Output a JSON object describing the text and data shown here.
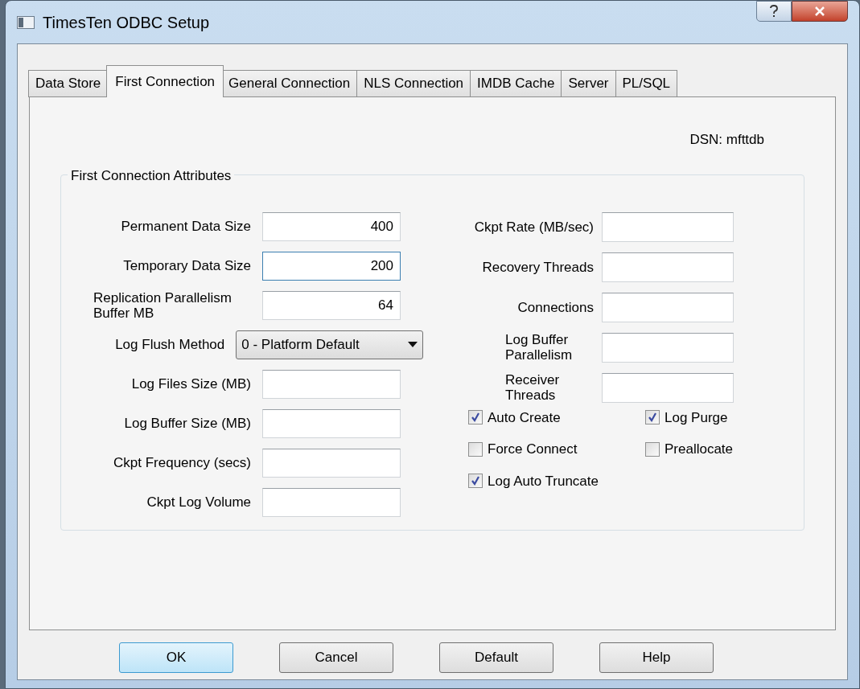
{
  "window": {
    "title": "TimesTen ODBC Setup"
  },
  "tabs": [
    {
      "label": "Data Store",
      "selected": false
    },
    {
      "label": "First Connection",
      "selected": true
    },
    {
      "label": "General Connection",
      "selected": false
    },
    {
      "label": "NLS Connection",
      "selected": false
    },
    {
      "label": "IMDB Cache",
      "selected": false
    },
    {
      "label": "Server",
      "selected": false
    },
    {
      "label": "PL/SQL",
      "selected": false
    }
  ],
  "dsn": "DSN: mfttdb",
  "group": {
    "title": "First Connection Attributes"
  },
  "left_fields": [
    {
      "kind": "text",
      "label": "Permanent Data Size",
      "value": "400",
      "focused": false
    },
    {
      "kind": "text",
      "label": "Temporary Data Size",
      "value": "200",
      "focused": true
    },
    {
      "kind": "text",
      "label": "Replication Parallelism Buffer MB",
      "value": "64",
      "focused": false
    },
    {
      "kind": "dropdown",
      "label": "Log Flush Method",
      "value": "0 - Platform Default"
    },
    {
      "kind": "text",
      "label": "Log Files Size (MB)",
      "focused": false
    },
    {
      "kind": "text",
      "label": "Log Buffer Size (MB)",
      "focused": false
    },
    {
      "kind": "text",
      "label": "Ckpt Frequency (secs)",
      "focused": false
    },
    {
      "kind": "text",
      "label": "Ckpt Log Volume",
      "focused": false
    }
  ],
  "right_fields": [
    {
      "label": "Ckpt Rate (MB/sec)"
    },
    {
      "label": "Recovery Threads"
    },
    {
      "label": "Connections"
    },
    {
      "label": "Log Buffer Parallelism"
    },
    {
      "label": "Receiver Threads"
    }
  ],
  "checkboxes": [
    {
      "label": "Auto Create",
      "checked": true
    },
    {
      "label": "Log Purge",
      "checked": true
    },
    {
      "label": "Force Connect",
      "checked": false
    },
    {
      "label": "Preallocate",
      "checked": false
    },
    {
      "label": "Log Auto Truncate",
      "checked": true
    }
  ],
  "buttons": [
    {
      "label": "OK",
      "default": true
    },
    {
      "label": "Cancel",
      "default": false
    },
    {
      "label": "Default",
      "default": false
    },
    {
      "label": "Help",
      "default": false
    }
  ]
}
